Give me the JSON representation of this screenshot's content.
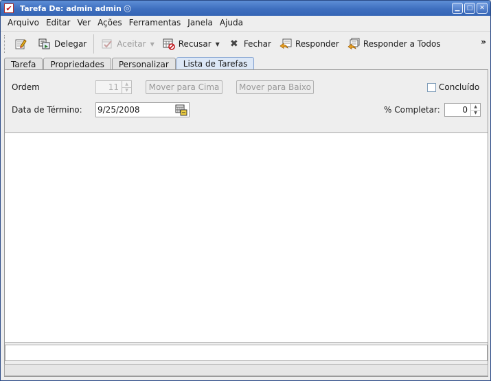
{
  "window": {
    "title": "Tarefa De: admin admin",
    "app_icon_glyph": "✔",
    "controls": {
      "minimize": "▁",
      "maximize": "□",
      "close": "✕"
    }
  },
  "menubar": {
    "items": [
      "Arquivo",
      "Editar",
      "Ver",
      "Ações",
      "Ferramentas",
      "Janela",
      "Ajuda"
    ]
  },
  "toolbar": {
    "items": [
      {
        "label": "",
        "icon": "edit-note-icon"
      },
      {
        "label": "Delegar",
        "icon": "delegate-icon"
      },
      {
        "label": "Aceitar",
        "icon": "accept-icon",
        "disabled": true
      },
      {
        "label": "Recusar",
        "icon": "decline-icon"
      },
      {
        "label": "Fechar",
        "icon": "close-x-icon"
      },
      {
        "label": "Responder",
        "icon": "reply-icon"
      },
      {
        "label": "Responder a Todos",
        "icon": "reply-all-icon"
      }
    ],
    "more": "»"
  },
  "tabs": {
    "items": [
      "Tarefa",
      "Propriedades",
      "Personalizar",
      "Lista de Tarefas"
    ],
    "active": "Lista de Tarefas"
  },
  "form": {
    "ordem_label": "Ordem",
    "ordem_value": "11",
    "move_up_label": "Mover para Cima",
    "move_down_label": "Mover para Baixo",
    "concluido_label": "Concluído",
    "data_termino_label": "Data de Término:",
    "data_termino_value": "9/25/2008",
    "percent_label": "% Completar:",
    "percent_value": "0"
  },
  "colors": {
    "titlebar": "#3e6fbf",
    "active_tab": "#dce7f6",
    "accent_red": "#c0141a"
  }
}
